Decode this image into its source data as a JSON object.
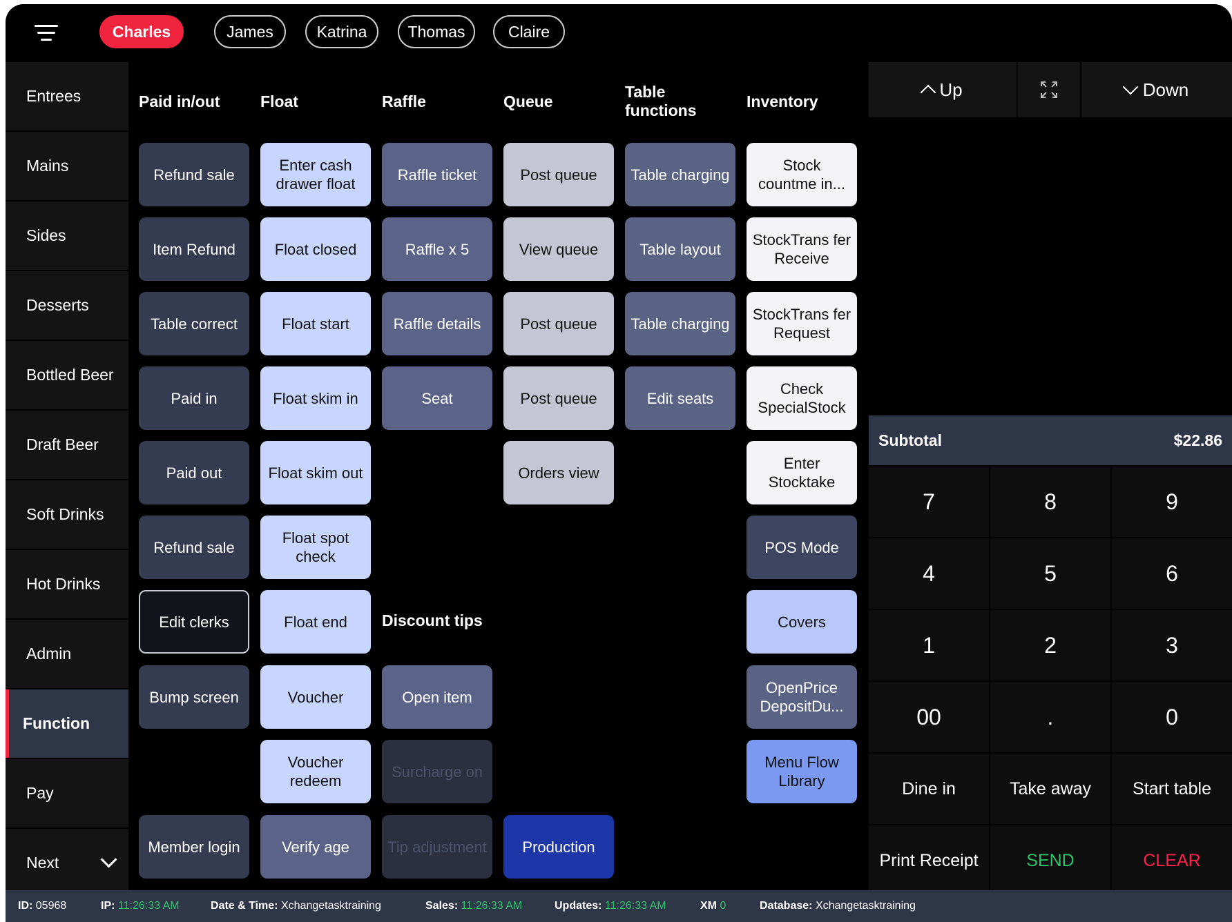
{
  "clerks": [
    "Charles",
    "James",
    "Katrina",
    "Thomas",
    "Claire"
  ],
  "sidebar": [
    "Entrees",
    "Mains",
    "Sides",
    "Desserts",
    "Bottled Beer",
    "Draft Beer",
    "Soft Drinks",
    "Hot Drinks",
    "Admin",
    "Function",
    "Pay",
    "Next"
  ],
  "columns": {
    "paid": "Paid in/out",
    "float": "Float",
    "raffle": "Raffle",
    "queue": "Queue",
    "table": "Table functions",
    "inventory": "Inventory",
    "discount": "Discount tips"
  },
  "buttons": {
    "paid": [
      "Refund sale",
      "Item Refund",
      "Table correct",
      "Paid in",
      "Paid out",
      "Refund sale",
      "Edit clerks",
      "Bump screen",
      "Member login"
    ],
    "float": [
      "Enter cash drawer float",
      "Float closed",
      "Float start",
      "Float skim in",
      "Float skim out",
      "Float spot check",
      "Float end",
      "Voucher",
      "Voucher redeem",
      "Verify age"
    ],
    "raffle": [
      "Raffle ticket",
      "Raffle x 5",
      "Raffle details",
      "Seat",
      "Open item",
      "Surcharge on",
      "Tip adjustment"
    ],
    "queue": [
      "Post queue",
      "View queue",
      "Post queue",
      "Post queue",
      "Orders view",
      "Production"
    ],
    "table": [
      "Table charging",
      "Table layout",
      "Table charging",
      "Edit seats"
    ],
    "inventory": [
      "Stock countme in...",
      "StockTrans fer Receive",
      "StockTrans fer Request",
      "Check SpecialStock",
      "Enter Stocktake",
      "POS Mode",
      "Covers",
      "OpenPrice DepositDu...",
      "Menu Flow Library"
    ]
  },
  "right": {
    "up": "Up",
    "down": "Down",
    "subtotal_label": "Subtotal",
    "subtotal_value": "$22.86",
    "keys": [
      "7",
      "8",
      "9",
      "4",
      "5",
      "6",
      "1",
      "2",
      "3",
      "00",
      ".",
      "0"
    ],
    "order_types": [
      "Dine in",
      "Take away",
      "Start table"
    ],
    "actions": [
      "Print Receipt",
      "SEND",
      "CLEAR"
    ]
  },
  "status": {
    "id_label": "ID:",
    "id_value": "05968",
    "ip_label": "IP:",
    "ip_value": "11:26:33 AM",
    "dt_label": "Date & Time:",
    "dt_value": "Xchangetasktraining",
    "sales_label": "Sales:",
    "sales_value": "11:26:33 AM",
    "updates_label": "Updates:",
    "updates_value": "11:26:33 AM",
    "xm_label": "XM",
    "xm_value": "0",
    "db_label": "Database:",
    "db_value": "Xchangetasktraining"
  },
  "colors": {
    "accent": "#f0243f",
    "send": "#29c46a",
    "clear": "#ff1f4a",
    "status_value": "#2ec46b"
  }
}
